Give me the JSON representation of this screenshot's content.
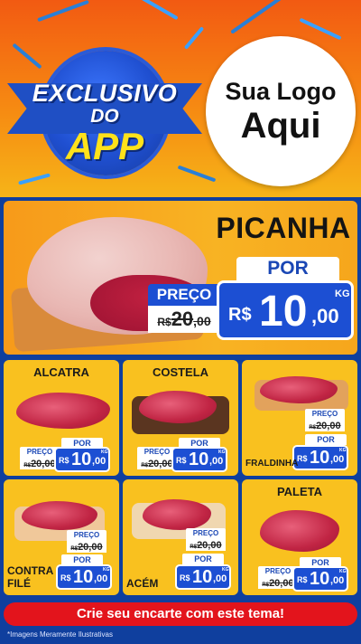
{
  "header": {
    "badge": {
      "line1": "EXCLUSIVO",
      "line2": "DO",
      "line3": "APP"
    },
    "logo": {
      "line1": "Sua Logo",
      "line2": "Aqui"
    }
  },
  "hero": {
    "title": "PICANHA",
    "preco_label": "PREÇO",
    "old_currency": "R$",
    "old_value": "20",
    "old_decimals": ",00",
    "por_label": "POR",
    "currency": "R$",
    "price_int": "10",
    "price_dec": ",00",
    "unit": "KG"
  },
  "products": [
    {
      "name": "ALCATRA",
      "preco_label": "PREÇO",
      "old": "20,00",
      "old_currency": "R$",
      "por_label": "POR",
      "currency": "R$",
      "price_int": "10",
      "price_dec": ",00",
      "unit": "KG"
    },
    {
      "name": "COSTELA",
      "preco_label": "PREÇO",
      "old": "20,00",
      "old_currency": "R$",
      "por_label": "POR",
      "currency": "R$",
      "price_int": "10",
      "price_dec": ",00",
      "unit": "KG"
    },
    {
      "name": "FRALDINHA",
      "preco_label": "PREÇO",
      "old": "20,00",
      "old_currency": "R$",
      "por_label": "POR",
      "currency": "R$",
      "price_int": "10",
      "price_dec": ",00",
      "unit": "KG"
    },
    {
      "name_line1": "CONTRA",
      "name_line2": "FILÉ",
      "preco_label": "PREÇO",
      "old": "20,00",
      "old_currency": "R$",
      "por_label": "POR",
      "currency": "R$",
      "price_int": "10",
      "price_dec": ",00",
      "unit": "KG"
    },
    {
      "name": "ACÉM",
      "preco_label": "PREÇO",
      "old": "20,00",
      "old_currency": "R$",
      "por_label": "POR",
      "currency": "R$",
      "price_int": "10",
      "price_dec": ",00",
      "unit": "KG"
    },
    {
      "name": "PALETA",
      "preco_label": "PREÇO",
      "old": "20,00",
      "old_currency": "R$",
      "por_label": "POR",
      "currency": "R$",
      "price_int": "10",
      "price_dec": ",00",
      "unit": "KG"
    }
  ],
  "footer": {
    "cta_label": "Crie seu encarte com este tema!",
    "disclaimer": "*Imagens Meramente Ilustrativas"
  },
  "colors": {
    "header_orange": "#f25a12",
    "panel_yellow": "#f9c11f",
    "price_blue": "#1c4fd3",
    "cta_red": "#e3141c",
    "background_blue": "#0f3f9e"
  }
}
